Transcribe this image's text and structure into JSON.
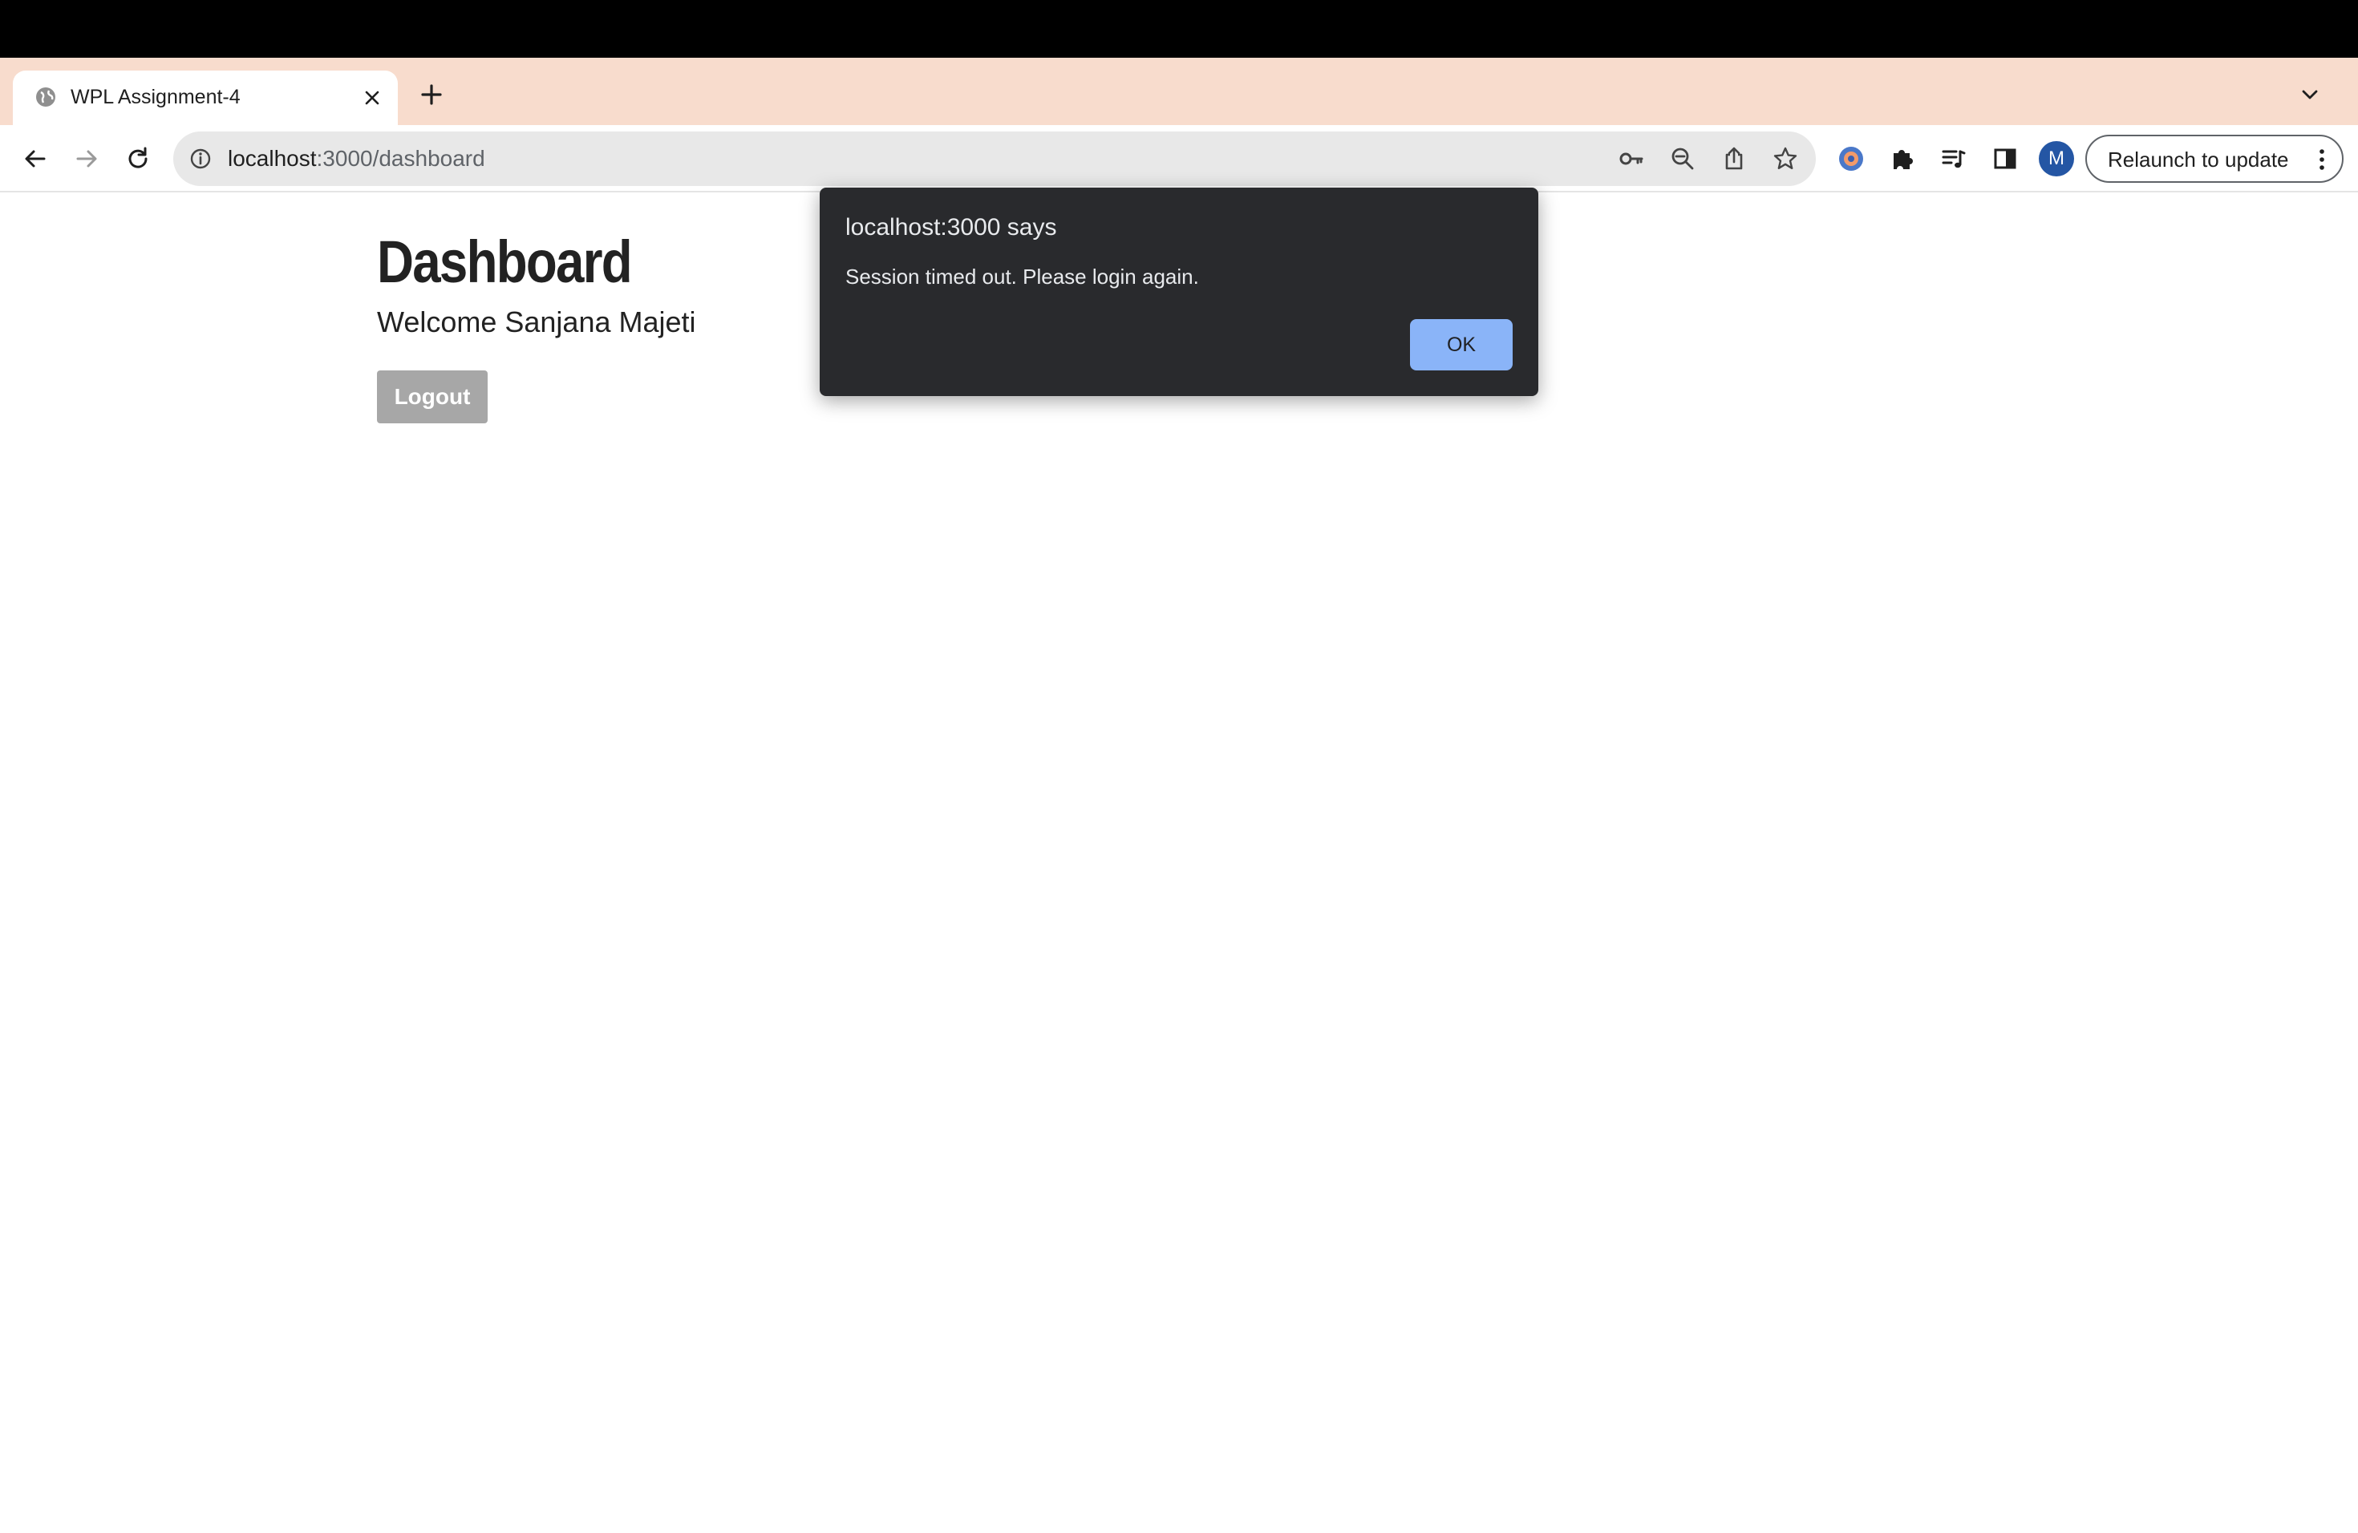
{
  "browser": {
    "tab": {
      "title": "WPL Assignment-4",
      "favicon_icon": "globe-icon",
      "close_icon": "close-icon"
    },
    "new_tab_icon": "plus-icon",
    "tab_search_icon": "chevron-down-icon",
    "toolbar": {
      "back_icon": "arrow-left-icon",
      "forward_icon": "arrow-right-icon",
      "reload_icon": "reload-icon"
    },
    "omnibox": {
      "info_icon": "info-icon",
      "url_host": "localhost",
      "url_path": ":3000/dashboard",
      "icons": [
        "key-icon",
        "zoom-out-icon",
        "share-icon",
        "star-icon"
      ]
    },
    "extensions": [
      "extension-logo-icon",
      "puzzle-icon",
      "media-queue-icon",
      "side-panel-icon"
    ],
    "profile_initial": "M",
    "relaunch_label": "Relaunch to update",
    "colors": {
      "tabstrip_bg": "#f8dccd",
      "avatar_bg": "#2456a4"
    }
  },
  "page": {
    "title": "Dashboard",
    "welcome": "Welcome Sanjana Majeti",
    "logout_label": "Logout"
  },
  "dialog": {
    "title": "localhost:3000 says",
    "message": "Session timed out. Please login again.",
    "ok_label": "OK",
    "colors": {
      "background": "#292a2d",
      "ok_button": "#8ab4f8"
    }
  }
}
